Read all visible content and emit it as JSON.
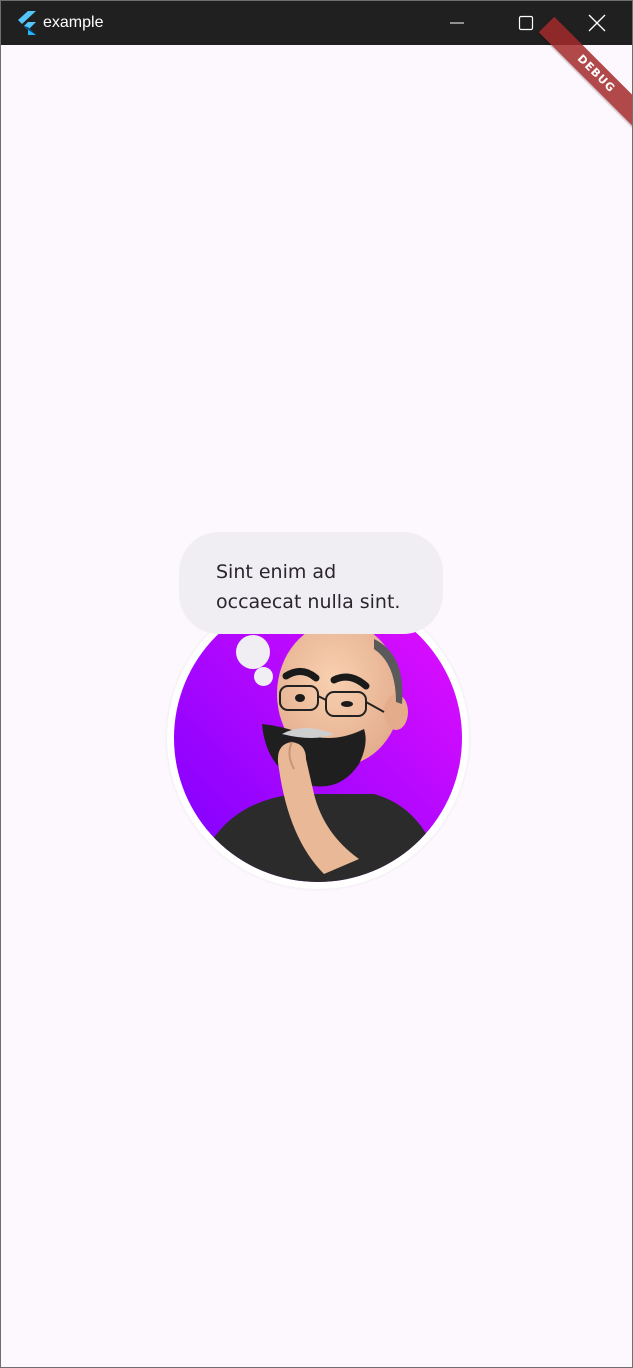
{
  "window": {
    "title": "example",
    "controls": {
      "minimize_icon": "minimize-icon",
      "maximize_icon": "maximize-icon",
      "close_icon": "close-icon"
    }
  },
  "debug_banner": {
    "label": "DEBUG",
    "color": "#a32a2a"
  },
  "bubble": {
    "text": "Sint enim ad occaecat nulla sint."
  },
  "avatar": {
    "gradient": [
      "#7a00ff",
      "#e60fff"
    ],
    "description_icon": "thinking-avatar-icon"
  },
  "colors": {
    "background": "#fdf7fe",
    "titlebar": "#202020",
    "bubble": "#f1eef3"
  }
}
